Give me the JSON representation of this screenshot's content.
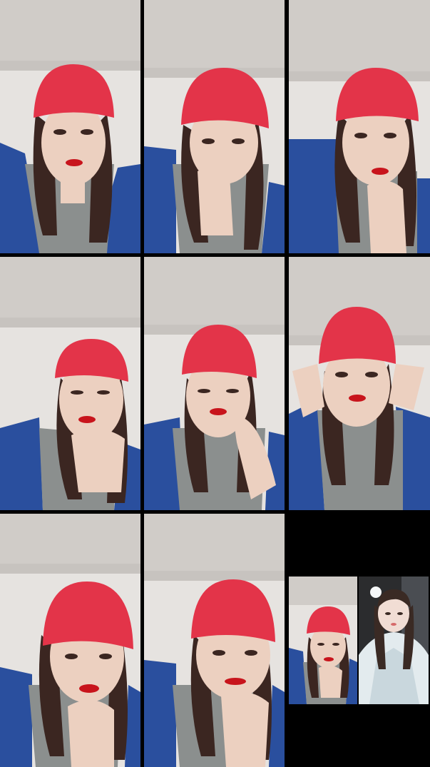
{
  "layout": {
    "rows": 3,
    "columns": 3,
    "background": "#000000"
  },
  "tiles": [
    {
      "id": 1,
      "pose": "neutral"
    },
    {
      "id": 2,
      "pose": "hand-to-mouth"
    },
    {
      "id": 3,
      "pose": "chin-on-hand"
    },
    {
      "id": 4,
      "pose": "head-tilt-hand"
    },
    {
      "id": 5,
      "pose": "eyes-closed-hand-neck"
    },
    {
      "id": 6,
      "pose": "hands-raised"
    },
    {
      "id": 7,
      "pose": "hand-on-chin"
    },
    {
      "id": 8,
      "pose": "smile-hand-chin"
    }
  ],
  "pip": {
    "left_tile": "small-selfie",
    "right_tile": "remote-guest"
  },
  "colors": {
    "beanie": "#e33449",
    "shirt_blue": "#2a4f9e",
    "tank_gray": "#8b8f8e",
    "hair": "#3b2621",
    "skin": "#ecd0c0",
    "lips": "#c8141c",
    "wall": "#e6e3e0",
    "ceiling": "#d0ccc8"
  }
}
